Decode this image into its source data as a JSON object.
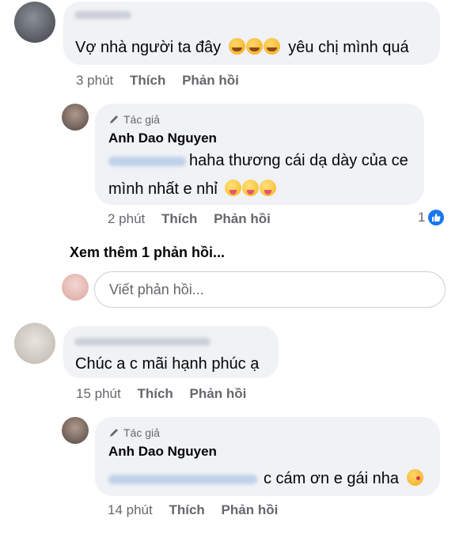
{
  "comments": [
    {
      "text": "Vợ nhà người ta đây",
      "text_suffix": "yêu chị mình quá",
      "emoji": [
        "smiling-face-with-hearts-icon",
        "smiling-face-with-hearts-icon",
        "smiling-face-with-hearts-icon"
      ],
      "time": "3 phút",
      "like_label": "Thích",
      "reply_label": "Phản hồi"
    },
    {
      "author_badge": "Tác giả",
      "author": "Anh Dao Nguyen",
      "text_line1": "haha thương cái dạ dày của ce",
      "text_line2": "mình nhất e nhỉ",
      "emoji": [
        "zany-face-icon",
        "zany-face-icon",
        "zany-face-icon"
      ],
      "time": "2 phút",
      "like_label": "Thích",
      "reply_label": "Phản hồi",
      "reaction_count": "1"
    },
    {
      "text": "Chúc a c mãi hạnh phúc ạ",
      "time": "15 phút",
      "like_label": "Thích",
      "reply_label": "Phản hồi"
    },
    {
      "author_badge": "Tác giả",
      "author": "Anh Dao Nguyen",
      "text": "c cám ơn e gái nha",
      "emoji": [
        "face-blowing-kiss-icon"
      ],
      "time": "14 phút",
      "like_label": "Thích",
      "reply_label": "Phản hồi"
    }
  ],
  "more_replies": "Xem thêm 1 phản hồi...",
  "reply_input": {
    "placeholder": "Viết phản hồi..."
  },
  "colors": {
    "bubble": "#f0f2f5",
    "meta": "#65676b",
    "text": "#050505",
    "like_blue": "#1877f2"
  }
}
